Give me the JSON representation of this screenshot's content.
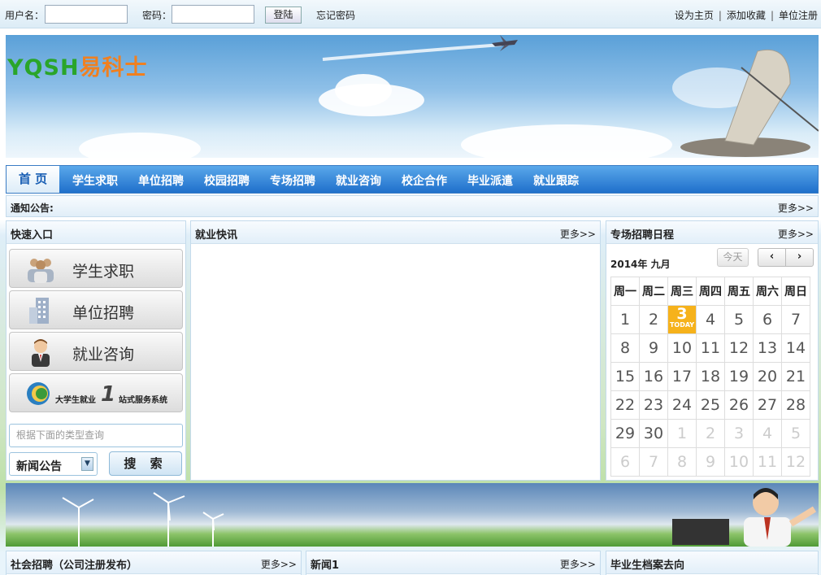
{
  "topbar": {
    "username_label": "用户名：",
    "password_label": "密码：",
    "login_button": "登陆",
    "forgot_password": "忘记密码",
    "links": [
      "设为主页",
      "添加收藏",
      "单位注册"
    ],
    "separator": "|"
  },
  "banner": {
    "logo_latin": "YQSH",
    "logo_cn": "易科士",
    "logo_colors": {
      "latin": "#2aa52a",
      "cn": "#f08020"
    }
  },
  "nav": {
    "home": "首 页",
    "items": [
      "学生求职",
      "单位招聘",
      "校园招聘",
      "专场招聘",
      "就业咨询",
      "校企合作",
      "毕业派遣",
      "就业跟踪"
    ]
  },
  "notice": {
    "label": "通知公告:",
    "more": "更多>>"
  },
  "quick": {
    "title": "快速入口",
    "buttons": [
      "学生求职",
      "单位招聘",
      "就业咨询"
    ],
    "service_badge": {
      "left": "大学生就业",
      "num": "1",
      "right": "站式服务系统"
    },
    "search_placeholder": "根据下面的类型查询",
    "select_value": "新闻公告",
    "search_button": "搜 索"
  },
  "news": {
    "title": "就业快讯",
    "more": "更多>>"
  },
  "calendar": {
    "title": "专场招聘日程",
    "more": "更多>>",
    "month_label": "2014年 九月",
    "today_button": "今天",
    "prev": "‹",
    "next": "›",
    "weekdays": [
      "周一",
      "周二",
      "周三",
      "周四",
      "周五",
      "周六",
      "周日"
    ],
    "today_tag": "TODAY",
    "rows": [
      [
        "1",
        "2",
        "3",
        "4",
        "5",
        "6",
        "7"
      ],
      [
        "8",
        "9",
        "10",
        "11",
        "12",
        "13",
        "14"
      ],
      [
        "15",
        "16",
        "17",
        "18",
        "19",
        "20",
        "21"
      ],
      [
        "22",
        "23",
        "24",
        "25",
        "26",
        "27",
        "28"
      ],
      [
        "29",
        "30",
        "1",
        "2",
        "3",
        "4",
        "5"
      ],
      [
        "6",
        "7",
        "8",
        "9",
        "10",
        "11",
        "12"
      ]
    ]
  },
  "bottom": {
    "social": {
      "title": "社会招聘（公司注册发布）",
      "more": "更多>>"
    },
    "news1": {
      "title": "新闻1",
      "more": "更多>>"
    },
    "archive": {
      "title": "毕业生档案去向"
    }
  }
}
